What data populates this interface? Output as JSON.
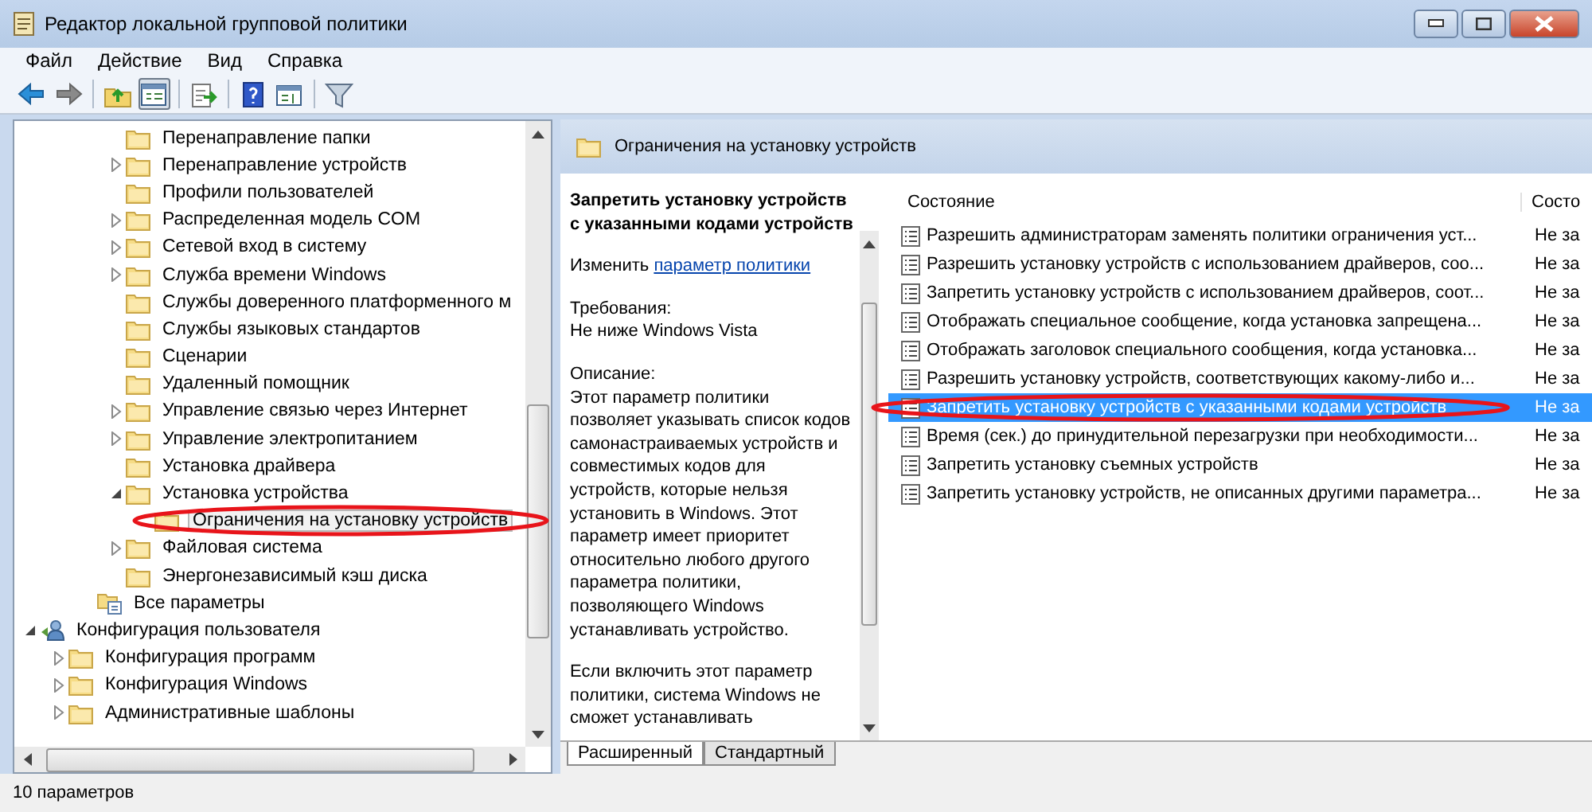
{
  "window": {
    "title": "Редактор локальной групповой политики"
  },
  "menu": [
    "Файл",
    "Действие",
    "Вид",
    "Справка"
  ],
  "toolbar": [
    {
      "kind": "back",
      "pressed": false
    },
    {
      "kind": "forward",
      "pressed": false
    },
    {
      "kind": "sep"
    },
    {
      "kind": "up",
      "pressed": false
    },
    {
      "kind": "tree",
      "pressed": true
    },
    {
      "kind": "sep"
    },
    {
      "kind": "export",
      "pressed": false
    },
    {
      "kind": "sep"
    },
    {
      "kind": "help",
      "pressed": false
    },
    {
      "kind": "panel",
      "pressed": false
    },
    {
      "kind": "sep"
    },
    {
      "kind": "filter",
      "pressed": false
    }
  ],
  "tree": [
    {
      "kind": "offscreen",
      "children": [
        {
          "kind": "offscreen",
          "children": [
            {
              "kind": "offscreen",
              "children": [
                {
                  "kind": "folder",
                  "label": "Перенаправление папки",
                  "selected": false,
                  "circled": false
                },
                {
                  "kind": "folder",
                  "label": "Перенаправление устройств",
                  "expanded": false,
                  "selected": false,
                  "circled": false
                },
                {
                  "kind": "folder",
                  "label": "Профили пользователей",
                  "selected": false,
                  "circled": false
                },
                {
                  "kind": "folder",
                  "label": "Распределенная модель COM",
                  "expanded": false,
                  "selected": false,
                  "circled": false
                },
                {
                  "kind": "folder",
                  "label": "Сетевой вход в систему",
                  "expanded": false,
                  "selected": false,
                  "circled": false
                },
                {
                  "kind": "folder",
                  "label": "Служба времени Windows",
                  "expanded": false,
                  "selected": false,
                  "circled": false
                },
                {
                  "kind": "folder",
                  "label": "Службы доверенного платформенного м",
                  "selected": false,
                  "circled": false
                },
                {
                  "kind": "folder",
                  "label": "Службы языковых стандартов",
                  "selected": false,
                  "circled": false
                },
                {
                  "kind": "folder",
                  "label": "Сценарии",
                  "selected": false,
                  "circled": false
                },
                {
                  "kind": "folder",
                  "label": "Удаленный помощник",
                  "selected": false,
                  "circled": false
                },
                {
                  "kind": "folder",
                  "label": "Управление связью через Интернет",
                  "expanded": false,
                  "selected": false,
                  "circled": false
                },
                {
                  "kind": "folder",
                  "label": "Управление электропитанием",
                  "expanded": false,
                  "selected": false,
                  "circled": false
                },
                {
                  "kind": "folder",
                  "label": "Установка драйвера",
                  "selected": false,
                  "circled": false
                },
                {
                  "kind": "folder",
                  "label": "Установка устройства",
                  "expanded": true,
                  "selected": false,
                  "circled": false,
                  "children": [
                    {
                      "kind": "folder",
                      "label": "Ограничения на установку устройств",
                      "selected": true,
                      "circled": true
                    }
                  ]
                },
                {
                  "kind": "folder",
                  "label": "Файловая система",
                  "expanded": false,
                  "selected": false,
                  "circled": false
                },
                {
                  "kind": "folder",
                  "label": "Энергонезависимый кэш диска",
                  "selected": false,
                  "circled": false
                }
              ]
            },
            {
              "kind": "all-settings",
              "label": "Все параметры",
              "selected": false,
              "circled": false
            }
          ]
        }
      ]
    },
    {
      "kind": "user",
      "label": "Конфигурация пользователя",
      "expanded": true,
      "selected": false,
      "circled": false,
      "children": [
        {
          "kind": "folder",
          "label": "Конфигурация программ",
          "expanded": false,
          "selected": false,
          "circled": false
        },
        {
          "kind": "folder",
          "label": "Конфигурация Windows",
          "expanded": false,
          "selected": false,
          "circled": false
        },
        {
          "kind": "folder",
          "label": "Административные шаблоны",
          "expanded": false,
          "selected": false,
          "circled": false
        }
      ]
    }
  ],
  "details": {
    "header": "Ограничения на установку устройств",
    "title": "Запретить установку устройств с указанными кодами устройств",
    "edit_prefix": "Изменить",
    "edit_link": "параметр политики",
    "requirements_label": "Требования:",
    "requirements": "Не ниже Windows Vista",
    "description_label": "Описание:",
    "description": "Этот параметр политики позволяет указывать список кодов самонастраиваемых устройств и совместимых кодов для устройств, которые нельзя установить в Windows. Этот параметр имеет приоритет относительно любого другого параметра политики, позволяющего Windows устанавливать устройство.",
    "description_more": "Если включить этот параметр политики, система Windows не сможет устанавливать"
  },
  "table": {
    "columns": [
      "Состояние",
      "Состо"
    ],
    "rows": [
      {
        "name": "Разрешить администраторам заменять политики ограничения уст...",
        "state": "Не за",
        "selected": false,
        "circled": false
      },
      {
        "name": "Разрешить установку устройств с использованием драйверов, соо...",
        "state": "Не за",
        "selected": false,
        "circled": false
      },
      {
        "name": "Запретить установку устройств с использованием драйверов, соот...",
        "state": "Не за",
        "selected": false,
        "circled": false
      },
      {
        "name": "Отображать специальное сообщение, когда установка запрещена...",
        "state": "Не за",
        "selected": false,
        "circled": false
      },
      {
        "name": "Отображать заголовок специального сообщения, когда установка...",
        "state": "Не за",
        "selected": false,
        "circled": false
      },
      {
        "name": "Разрешить установку устройств, соответствующих какому-либо и...",
        "state": "Не за",
        "selected": false,
        "circled": false
      },
      {
        "name": "Запретить установку устройств с указанными кодами устройств",
        "state": "Не за",
        "selected": true,
        "circled": true
      },
      {
        "name": "Время (сек.) до принудительной перезагрузки при необходимости...",
        "state": "Не за",
        "selected": false,
        "circled": false
      },
      {
        "name": "Запретить установку съемных устройств",
        "state": "Не за",
        "selected": false,
        "circled": false
      },
      {
        "name": "Запретить установку устройств, не описанных другими параметра...",
        "state": "Не за",
        "selected": false,
        "circled": false
      }
    ]
  },
  "view_tabs": [
    {
      "label": "Расширенный",
      "selected": true
    },
    {
      "label": "Стандартный",
      "selected": false
    }
  ],
  "status_bar": "10 параметров"
}
